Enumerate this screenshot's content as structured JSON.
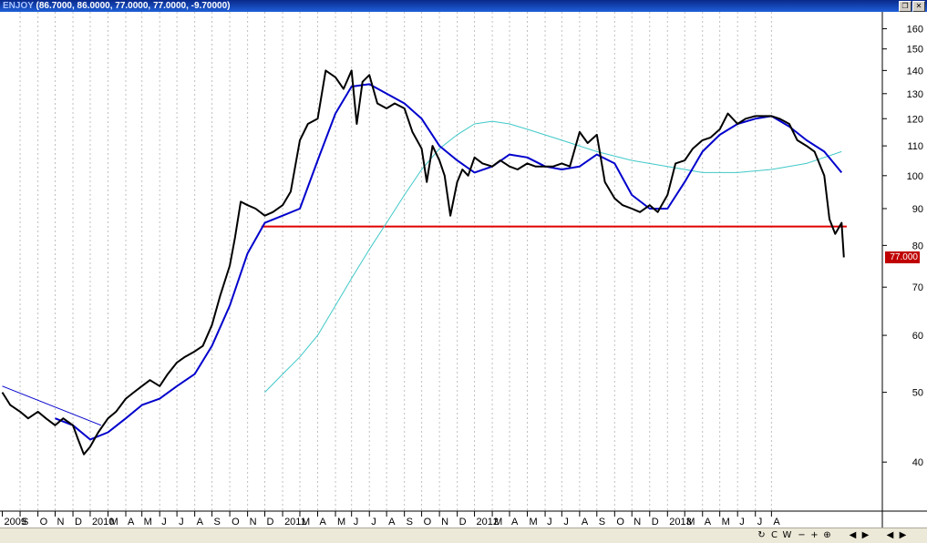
{
  "window": {
    "ticker": "ENJOY",
    "ohlc_readout": "(86.7000, 86.0000, 77.0000, 77.0000, -9.70000)",
    "restore_glyph": "❐",
    "close_glyph": "✕"
  },
  "price_tag": "77.000",
  "scrollbar": {
    "buttons": [
      "↻",
      "C",
      "W",
      "−",
      "+",
      "⊕",
      "◀",
      "▶",
      "◀",
      "▶"
    ]
  },
  "colors": {
    "price": "#000000",
    "ma_short": "#0000cc",
    "ma_long": "#40c8c8",
    "support": "#e00000",
    "trend": "#0000cc",
    "grid": "#bfbfbf"
  },
  "chart_data": {
    "type": "line",
    "scale": "log",
    "ylim": [
      35,
      165
    ],
    "y_ticks": [
      40,
      50,
      60,
      70,
      80,
      90,
      100,
      110,
      120,
      130,
      140,
      150,
      160
    ],
    "x_ticks": [
      "2009",
      "S",
      "O",
      "N",
      "D",
      "2010",
      "M",
      "A",
      "M",
      "J",
      "J",
      "A",
      "S",
      "O",
      "N",
      "D",
      "2011",
      "M",
      "A",
      "M",
      "J",
      "J",
      "A",
      "S",
      "O",
      "N",
      "D",
      "2012",
      "M",
      "A",
      "M",
      "J",
      "J",
      "A",
      "S",
      "O",
      "N",
      "D",
      "2013",
      "M",
      "A",
      "M",
      "J",
      "J",
      "A"
    ],
    "support_level": 85,
    "series": [
      {
        "name": "",
        "role": "price",
        "x": [
          "2009-07-01",
          "2009-07-15",
          "2009-08-01",
          "2009-08-15",
          "2009-09-01",
          "2009-09-15",
          "2009-10-01",
          "2009-10-15",
          "2009-11-01",
          "2009-11-10",
          "2009-11-20",
          "2009-12-01",
          "2009-12-15",
          "2010-01-01",
          "2010-01-15",
          "2010-02-01",
          "2010-02-15",
          "2010-03-01",
          "2010-03-15",
          "2010-04-01",
          "2010-04-15",
          "2010-05-01",
          "2010-05-15",
          "2010-06-01",
          "2010-06-15",
          "2010-07-01",
          "2010-07-15",
          "2010-08-01",
          "2010-08-10",
          "2010-08-20",
          "2010-09-01",
          "2010-09-15",
          "2010-10-01",
          "2010-10-15",
          "2010-11-01",
          "2010-11-15",
          "2010-12-01",
          "2010-12-15",
          "2011-01-01",
          "2011-01-15",
          "2011-02-01",
          "2011-02-15",
          "2011-03-01",
          "2011-03-10",
          "2011-03-20",
          "2011-04-01",
          "2011-04-15",
          "2011-05-01",
          "2011-05-15",
          "2011-06-01",
          "2011-06-15",
          "2011-07-01",
          "2011-07-10",
          "2011-07-20",
          "2011-08-01",
          "2011-08-10",
          "2011-08-20",
          "2011-09-01",
          "2011-09-10",
          "2011-09-20",
          "2011-10-01",
          "2011-10-15",
          "2011-11-01",
          "2011-11-15",
          "2011-12-01",
          "2011-12-15",
          "2012-01-01",
          "2012-01-15",
          "2012-02-01",
          "2012-02-15",
          "2012-03-01",
          "2012-03-15",
          "2012-04-01",
          "2012-04-15",
          "2012-05-01",
          "2012-05-15",
          "2012-06-01",
          "2012-06-15",
          "2012-07-01",
          "2012-07-15",
          "2012-08-01",
          "2012-08-15",
          "2012-09-01",
          "2012-09-15",
          "2012-10-01",
          "2012-10-15",
          "2012-11-01",
          "2012-11-15",
          "2012-12-01",
          "2012-12-15",
          "2013-01-01",
          "2013-01-15",
          "2013-02-01",
          "2013-02-15",
          "2013-03-01",
          "2013-03-15",
          "2013-04-01",
          "2013-04-15",
          "2013-05-01",
          "2013-05-15",
          "2013-06-01",
          "2013-06-10",
          "2013-06-20",
          "2013-07-01",
          "2013-07-05"
        ],
        "values": [
          50,
          48,
          47,
          46,
          47,
          46,
          45,
          46,
          45,
          43,
          41,
          42,
          44,
          46,
          47,
          49,
          50,
          51,
          52,
          51,
          53,
          55,
          56,
          57,
          58,
          62,
          68,
          75,
          82,
          92,
          91,
          90,
          88,
          89,
          91,
          95,
          112,
          118,
          120,
          140,
          137,
          132,
          140,
          118,
          135,
          138,
          126,
          124,
          126,
          124,
          115,
          109,
          98,
          110,
          105,
          100,
          88,
          98,
          102,
          100,
          106,
          104,
          103,
          105,
          103,
          102,
          104,
          103,
          103,
          103,
          104,
          103,
          115,
          111,
          114,
          98,
          93,
          91,
          90,
          89,
          91,
          89,
          94,
          104,
          105,
          109,
          112,
          113,
          116,
          122,
          118,
          120,
          121,
          121,
          121,
          120,
          118,
          112,
          110,
          108,
          100,
          87,
          83,
          86,
          77
        ]
      },
      {
        "name": "",
        "role": "ma_short",
        "x": [
          "2009-10-01",
          "2009-11-01",
          "2009-12-01",
          "2010-01-01",
          "2010-02-01",
          "2010-03-01",
          "2010-04-01",
          "2010-05-01",
          "2010-06-01",
          "2010-07-01",
          "2010-08-01",
          "2010-09-01",
          "2010-10-01",
          "2010-11-01",
          "2010-12-01",
          "2011-01-01",
          "2011-02-01",
          "2011-03-01",
          "2011-04-01",
          "2011-05-01",
          "2011-06-01",
          "2011-07-01",
          "2011-08-01",
          "2011-09-01",
          "2011-10-01",
          "2011-11-01",
          "2011-12-01",
          "2012-01-01",
          "2012-02-01",
          "2012-03-01",
          "2012-04-01",
          "2012-05-01",
          "2012-06-01",
          "2012-07-01",
          "2012-08-01",
          "2012-09-01",
          "2012-10-01",
          "2012-11-01",
          "2012-12-01",
          "2013-01-01",
          "2013-02-01",
          "2013-03-01",
          "2013-04-01",
          "2013-05-01",
          "2013-06-01",
          "2013-07-01"
        ],
        "values": [
          46,
          45,
          43,
          44,
          46,
          48,
          49,
          51,
          53,
          58,
          66,
          78,
          86,
          88,
          90,
          105,
          122,
          133,
          134,
          130,
          126,
          120,
          110,
          105,
          101,
          103,
          107,
          106,
          103,
          102,
          103,
          107,
          104,
          94,
          90,
          90,
          98,
          108,
          114,
          118,
          120,
          121,
          117,
          112,
          108,
          101
        ]
      },
      {
        "name": "",
        "role": "ma_long",
        "x": [
          "2010-10-01",
          "2010-11-01",
          "2010-12-01",
          "2011-01-01",
          "2011-02-01",
          "2011-03-01",
          "2011-04-01",
          "2011-05-01",
          "2011-06-01",
          "2011-07-01",
          "2011-08-01",
          "2011-09-01",
          "2011-10-01",
          "2011-11-01",
          "2011-12-01",
          "2012-01-01",
          "2012-03-01",
          "2012-05-01",
          "2012-07-01",
          "2012-09-01",
          "2012-11-01",
          "2013-01-01",
          "2013-03-01",
          "2013-05-01",
          "2013-07-01"
        ],
        "values": [
          50,
          53,
          56,
          60,
          66,
          72,
          79,
          86,
          94,
          102,
          109,
          114,
          118,
          119,
          118,
          116,
          112,
          108,
          105,
          103,
          101,
          101,
          102,
          104,
          108
        ]
      },
      {
        "name": "",
        "role": "trend",
        "x": [
          "2009-07-01",
          "2009-12-20"
        ],
        "values": [
          51,
          45
        ]
      }
    ]
  }
}
